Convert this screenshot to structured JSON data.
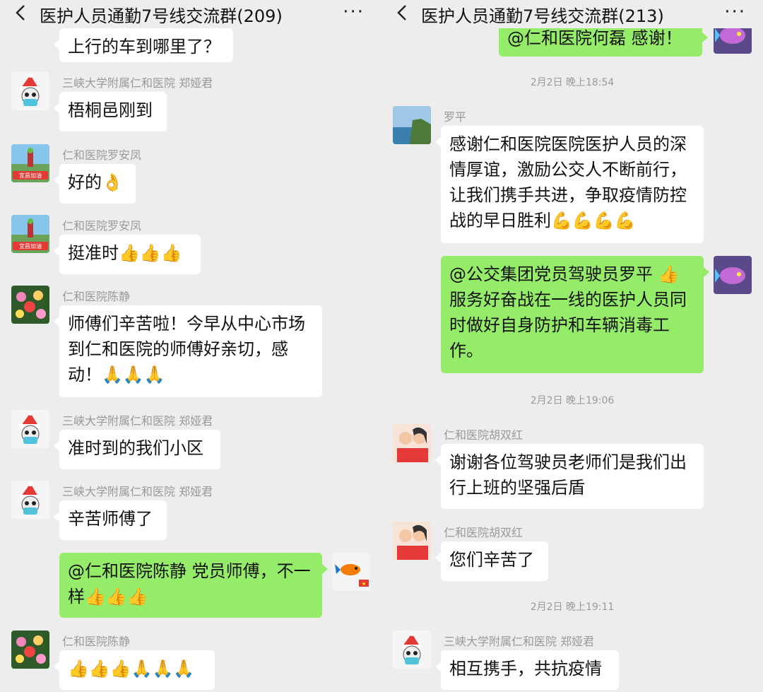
{
  "left": {
    "title": "医护人员通勤7号线交流群(209)",
    "more": "···",
    "messages": [
      {
        "sender": "",
        "text": "上行的车到哪里了？",
        "avatar": "red-partial-avatar",
        "dir": "in"
      },
      {
        "sender": "三峡大学附属仁和医院 郑娅君",
        "text": "梧桐邑刚到",
        "avatar": "santa-cartoon-avatar",
        "dir": "in"
      },
      {
        "sender": "仁和医院罗安凤",
        "text": "好的👌",
        "avatar": "yichang-runner-avatar",
        "dir": "in"
      },
      {
        "sender": "仁和医院罗安凤",
        "text": "挺准时👍👍👍",
        "avatar": "yichang-runner-avatar",
        "dir": "in"
      },
      {
        "sender": "仁和医院陈静",
        "text": "师傅们辛苦啦！今早从中心市场到仁和医院的师傅好亲切，感动！🙏🙏🙏",
        "avatar": "flowers-avatar",
        "dir": "in"
      },
      {
        "sender": "三峡大学附属仁和医院 郑娅君",
        "text": "准时到的我们小区",
        "avatar": "santa-cartoon-avatar",
        "dir": "in"
      },
      {
        "sender": "三峡大学附属仁和医院 郑娅君",
        "text": "辛苦师傅了",
        "avatar": "santa-cartoon-avatar",
        "dir": "in"
      },
      {
        "sender": "",
        "text": "@仁和医院陈静  党员师傅，不一样👍👍👍",
        "avatar": "goldfish-flag-avatar",
        "dir": "out"
      },
      {
        "sender": "仁和医院陈静",
        "text": "👍👍👍🙏🙏🙏",
        "avatar": "flowers-avatar",
        "dir": "in"
      }
    ]
  },
  "right": {
    "title": "医护人员通勤7号线交流群(213)",
    "more": "···",
    "timestamps": [
      "2月2日 晚上18:54",
      "2月2日 晚上19:06",
      "2月2日 晚上19:11"
    ],
    "messages": [
      {
        "sender": "",
        "text": "@仁和医院何磊  感谢！",
        "avatar": "fish-avatar",
        "dir": "out"
      },
      {
        "sender": "罗平",
        "text": "感谢仁和医院医院医护人员的深情厚谊，激励公交人不断前行，让我们携手共进，争取疫情防控战的早日胜利💪💪💪💪",
        "avatar": "coast-cliff-avatar",
        "dir": "in"
      },
      {
        "sender": "",
        "text": "@公交集团党员驾驶员罗平 👍服务好奋战在一线的医护人员同时做好自身防护和车辆消毒工作。",
        "avatar": "fish-avatar",
        "dir": "out"
      },
      {
        "sender": "仁和医院胡双红",
        "text": "谢谢各位驾驶员老师们是我们出行上班的坚强后盾",
        "avatar": "mother-child-avatar",
        "dir": "in"
      },
      {
        "sender": "仁和医院胡双红",
        "text": "您们辛苦了",
        "avatar": "mother-child-avatar",
        "dir": "in"
      },
      {
        "sender": "三峡大学附属仁和医院 郑娅君",
        "text": "相互携手，共抗疫情",
        "avatar": "santa-cartoon-avatar",
        "dir": "in"
      }
    ]
  },
  "colors": {
    "bg": "#ededed",
    "bubble_in": "#ffffff",
    "bubble_out": "#95ec69",
    "meta": "#999999"
  },
  "icons": {
    "back": "chevron-left-icon",
    "more": "more-dots-icon"
  }
}
